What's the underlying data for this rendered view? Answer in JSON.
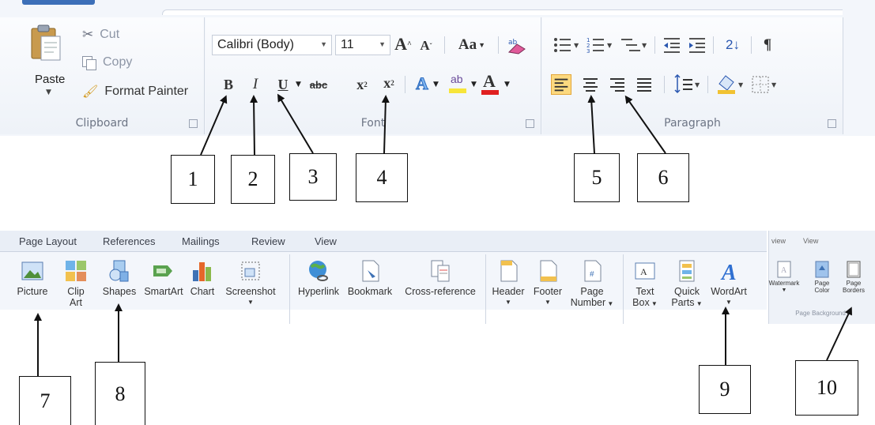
{
  "home_ribbon": {
    "clipboard": {
      "paste_label": "Paste",
      "cut_label": "Cut",
      "copy_label": "Copy",
      "format_painter_label": "Format Painter",
      "group_label": "Clipboard"
    },
    "font": {
      "font_name": "Calibri (Body)",
      "font_size": "11",
      "grow_font": "A",
      "shrink_font": "A",
      "change_case": "Aa",
      "bold": "B",
      "italic": "I",
      "underline": "U",
      "strikethrough": "abc",
      "subscript": "x",
      "superscript": "x",
      "font_color": "A",
      "group_label": "Font"
    },
    "paragraph": {
      "sort": "2↓",
      "show_marks": "¶",
      "group_label": "Paragraph"
    }
  },
  "insert_ribbon": {
    "tabs": [
      "Page Layout",
      "References",
      "Mailings",
      "Review",
      "View"
    ],
    "buttons": {
      "picture": "Picture",
      "clip_art_1": "Clip",
      "clip_art_2": "Art",
      "shapes": "Shapes",
      "smartart": "SmartArt",
      "chart": "Chart",
      "screenshot": "Screenshot",
      "hyperlink": "Hyperlink",
      "bookmark": "Bookmark",
      "cross_reference": "Cross-reference",
      "header": "Header",
      "footer": "Footer",
      "page_number_1": "Page",
      "page_number_2": "Number",
      "text_box_1": "Text",
      "text_box_2": "Box",
      "quick_parts_1": "Quick",
      "quick_parts_2": "Parts",
      "wordart": "WordArt"
    }
  },
  "page_layout_ribbon": {
    "tabs": [
      "view",
      "View"
    ],
    "watermark": "Watermark",
    "page_color_1": "Page",
    "page_color_2": "Color",
    "page_borders_1": "Page",
    "page_borders_2": "Borders",
    "group_label": "Page Background"
  },
  "callouts": [
    "1",
    "2",
    "3",
    "4",
    "5",
    "6",
    "7",
    "8",
    "9",
    "10"
  ],
  "colors": {
    "ribbon_bg": "#f3f6fb",
    "active_highlight": "#fcd97f",
    "highlight_yellow": "#f7e53a",
    "font_red": "#e02020",
    "wordart_blue": "#2f6fd1"
  }
}
